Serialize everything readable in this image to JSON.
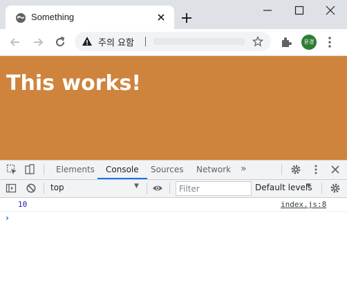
{
  "tab": {
    "title": "Something",
    "favicon": "globe-icon"
  },
  "omnibox": {
    "security_label": "주의 요함",
    "separator": "|"
  },
  "profile": {
    "initials": "윤경",
    "color": "#2e7d32"
  },
  "page": {
    "background": "#cf843d",
    "heading": "This works!"
  },
  "devtools": {
    "tabs": [
      "Elements",
      "Console",
      "Sources",
      "Network"
    ],
    "active_tab": "Console",
    "more_tabs": "»",
    "context": "top",
    "filter_placeholder": "Filter",
    "levels_label": "Default levels",
    "log": {
      "value": "10",
      "source": "index.js:8"
    },
    "prompt": "›"
  }
}
